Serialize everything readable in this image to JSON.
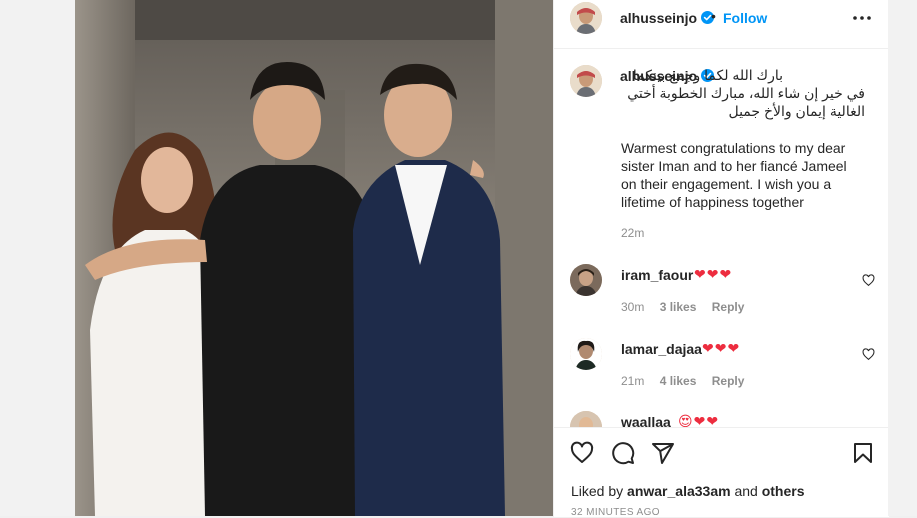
{
  "post": {
    "author": "alhusseinjo",
    "follow_label": "Follow",
    "separator": "•",
    "caption_arabic_line1": "بارك الله لكما وجمع بينكما",
    "caption_arabic_line2": "في خير إن شاء الله، مبارك الخطوبة أختي",
    "caption_arabic_line3": "الغالية إيمان والأخ جميل",
    "caption_english": "Warmest congratulations to my dear\nsister Iman and to her fiancé Jameel\non their engagement. I wish you a\nlifetime of happiness together",
    "caption_time": "22m"
  },
  "comments": [
    {
      "user": "iram_faour",
      "text": "❤❤❤",
      "time": "30m",
      "likes": "3 likes",
      "reply": "Reply"
    },
    {
      "user": "lamar_dajaa",
      "text": "❤❤❤",
      "time": "21m",
      "likes": "4 likes",
      "reply": "Reply"
    },
    {
      "user": "waallaa",
      "text": "😍❤❤"
    }
  ],
  "footer": {
    "liked_prefix": "Liked by ",
    "liked_user": "anwar_ala33am",
    "liked_and": " and ",
    "liked_others": "others",
    "time_ago": "32 MINUTES AGO"
  },
  "icons": [
    "more-icon",
    "verified-icon",
    "heart-icon",
    "comment-icon",
    "share-icon",
    "bookmark-icon"
  ],
  "colors": {
    "accent": "#0095f6",
    "heart": "#ed2d3f",
    "muted": "#8e8e8e",
    "text": "#262626"
  }
}
